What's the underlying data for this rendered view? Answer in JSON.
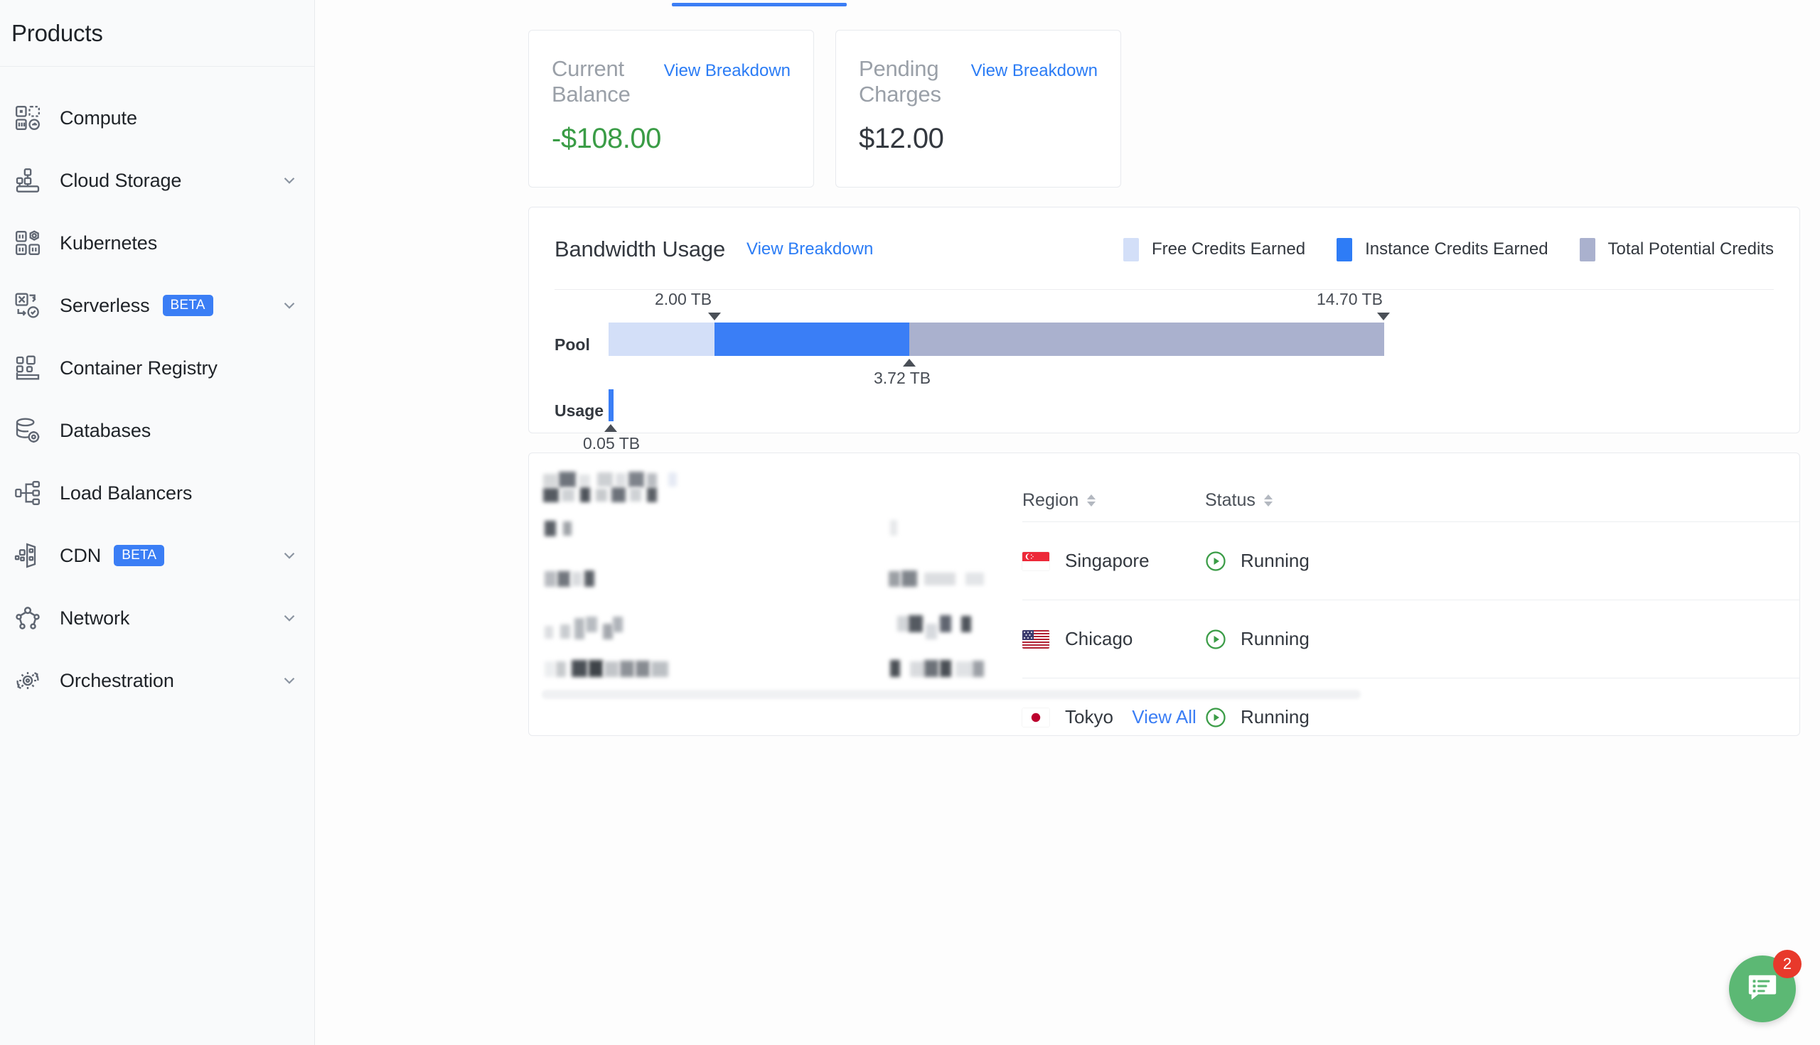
{
  "sidebar": {
    "title": "Products",
    "items": [
      {
        "label": "Compute",
        "icon": "compute-icon",
        "badge": null,
        "expandable": false
      },
      {
        "label": "Cloud Storage",
        "icon": "cloud-storage-icon",
        "badge": null,
        "expandable": true
      },
      {
        "label": "Kubernetes",
        "icon": "kubernetes-icon",
        "badge": null,
        "expandable": false
      },
      {
        "label": "Serverless",
        "icon": "serverless-icon",
        "badge": "BETA",
        "expandable": true
      },
      {
        "label": "Container Registry",
        "icon": "container-registry-icon",
        "badge": null,
        "expandable": false
      },
      {
        "label": "Databases",
        "icon": "database-icon",
        "badge": null,
        "expandable": false
      },
      {
        "label": "Load Balancers",
        "icon": "load-balancer-icon",
        "badge": null,
        "expandable": false
      },
      {
        "label": "CDN",
        "icon": "cdn-icon",
        "badge": "BETA",
        "expandable": true
      },
      {
        "label": "Network",
        "icon": "network-icon",
        "badge": null,
        "expandable": true
      },
      {
        "label": "Orchestration",
        "icon": "orchestration-icon",
        "badge": null,
        "expandable": true
      }
    ]
  },
  "balance_cards": [
    {
      "label": "Current Balance",
      "link": "View Breakdown",
      "value": "-$108.00",
      "value_color": "#3a9c46"
    },
    {
      "label": "Pending Charges",
      "link": "View Breakdown",
      "value": "$12.00",
      "value_color": "#33383f"
    }
  ],
  "bandwidth": {
    "title": "Bandwidth Usage",
    "link": "View Breakdown",
    "legend": [
      {
        "label": "Free Credits Earned",
        "color": "#d3dff8"
      },
      {
        "label": "Instance Credits Earned",
        "color": "#2e7cf6"
      },
      {
        "label": "Total Potential Credits",
        "color": "#aab1ce"
      }
    ],
    "rows": [
      {
        "label": "Pool"
      },
      {
        "label": "Usage"
      }
    ],
    "markers": {
      "free_credits": "2.00 TB",
      "instance_credits": "3.72 TB",
      "total_potential": "14.70 TB",
      "usage": "0.05 TB"
    }
  },
  "chart_data": {
    "type": "bar",
    "title": "Bandwidth Usage",
    "orientation": "horizontal",
    "stacked": true,
    "unit": "TB",
    "axis_max": 14.7,
    "series": [
      {
        "name": "Free Credits Earned",
        "color": "#d3dff8",
        "value": 2.0,
        "label": "2.00 TB"
      },
      {
        "name": "Instance Credits Earned",
        "color": "#2e7cf6",
        "value": 3.72,
        "label": "3.72 TB"
      },
      {
        "name": "Total Potential Credits",
        "color": "#aab1ce",
        "value": 14.7,
        "label": "14.70 TB"
      }
    ],
    "rows": [
      {
        "category": "Pool",
        "cumulative": [
          2.0,
          3.72,
          14.7
        ]
      },
      {
        "category": "Usage",
        "cumulative": [
          0.05
        ],
        "label": "0.05 TB"
      }
    ],
    "legend_position": "top-right",
    "grid": false
  },
  "instances_table": {
    "columns": [
      {
        "label": "Region",
        "sortable": true
      },
      {
        "label": "Status",
        "sortable": true
      }
    ],
    "rows": [
      {
        "region": "Singapore",
        "flag": "singapore-flag",
        "status": "Running",
        "status_color": "#3a9c46"
      },
      {
        "region": "Chicago",
        "flag": "usa-flag",
        "status": "Running",
        "status_color": "#3a9c46"
      },
      {
        "region": "Tokyo",
        "flag": "japan-flag",
        "status": "Running",
        "status_color": "#3a9c46"
      }
    ],
    "view_all_label": "View All"
  },
  "chat_widget": {
    "icon": "chat-icon",
    "badge_count": "2",
    "color": "#5cb874",
    "badge_color": "#e8392b"
  }
}
